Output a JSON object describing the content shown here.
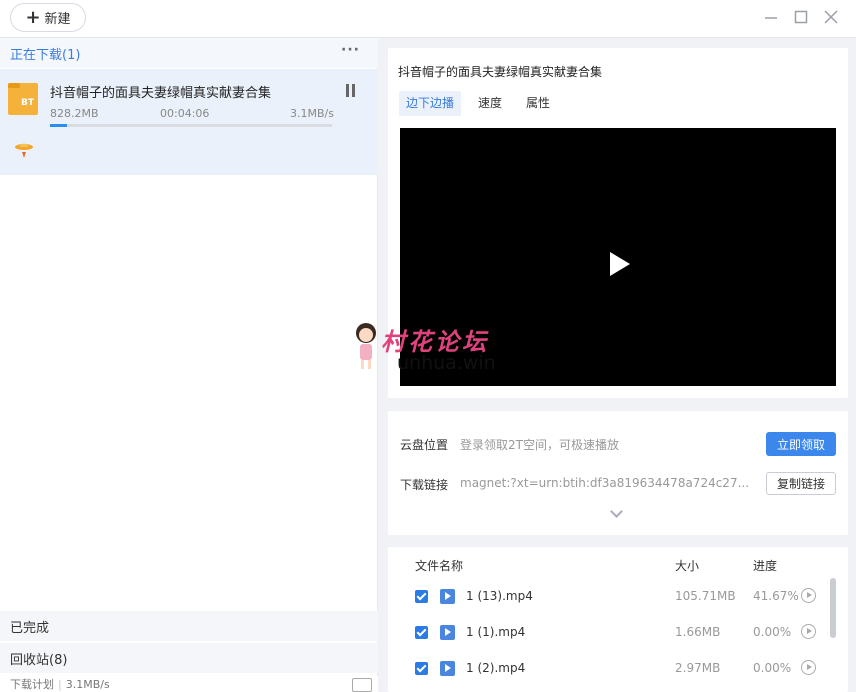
{
  "titlebar": {
    "new_button_label": "新建",
    "new_button_icon": "plus-icon",
    "minimize_icon": "minimize-icon",
    "maximize_icon": "maximize-icon",
    "close_icon": "close-icon"
  },
  "left": {
    "downloading_header": "正在下载(1)",
    "more_icon": "more-dots-icon",
    "task": {
      "title": "抖音帽子的面具夫妻绿帽真实献妻合集",
      "icon_text": "BT",
      "size": "828.2MB",
      "time_left": "00:04:06",
      "speed": "3.1MB/s",
      "progress_percent": 6
    },
    "completed_header": "已完成",
    "recycle_header": "回收站(8)",
    "footer": {
      "plan_label": "下载计划",
      "speed": "3.1MB/s"
    }
  },
  "right": {
    "title": "抖音帽子的面具夫妻绿帽真实献妻合集",
    "tabs": [
      "边下边播",
      "速度",
      "属性"
    ],
    "active_tab": "边下边播",
    "cloud_label": "云盘位置",
    "cloud_value": "登录领取2T空间，可极速播放",
    "claim_button": "立即领取",
    "link_label": "下载链接",
    "link_value": "magnet:?xt=urn:btih:df3a819634478a724c27...",
    "copy_button": "复制链接",
    "files": {
      "columns": [
        "文件名称",
        "大小",
        "进度"
      ],
      "rows": [
        {
          "name": "1 (13).mp4",
          "size": "105.71MB",
          "progress": "41.67%"
        },
        {
          "name": "1 (1).mp4",
          "size": "1.66MB",
          "progress": "0.00%"
        },
        {
          "name": "1 (2).mp4",
          "size": "2.97MB",
          "progress": "0.00%"
        }
      ]
    }
  },
  "watermark": {
    "line1": "村花论坛",
    "line2": "unhua.win"
  }
}
